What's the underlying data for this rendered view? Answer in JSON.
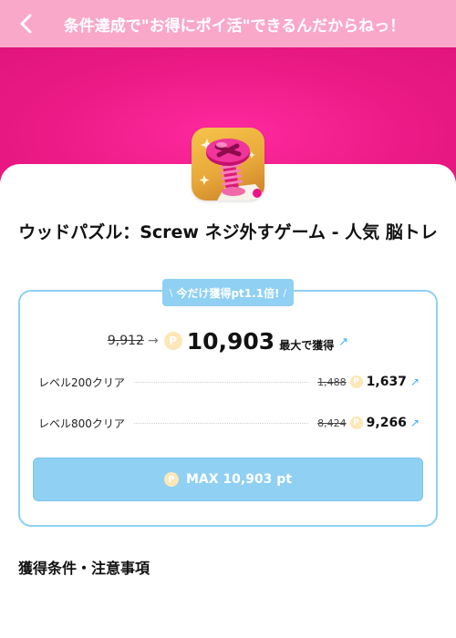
{
  "header": {
    "title": "条件達成で\"お得にポイ活\"できるんだからねっ！"
  },
  "app": {
    "title": "ウッドパズル：Screw ネジ外すゲーム - 人気 脳トレ"
  },
  "offer": {
    "banner_left": "\\",
    "banner_text": "今だけ獲得pt1.1倍!",
    "banner_right": "/",
    "old_total": "9,912",
    "new_total": "10,903",
    "max_label": "最大で獲得",
    "levels": [
      {
        "label": "レベル200クリア",
        "old": "1,488",
        "new": "1,637"
      },
      {
        "label": "レベル800クリア",
        "old": "8,424",
        "new": "9,266"
      }
    ],
    "button_label": "MAX 10,903 pt"
  },
  "conditions": {
    "title": "獲得条件・注意事項"
  },
  "colors": {
    "header_bg": "#f9a8c9",
    "hero_bg": "#ec1a86",
    "accent_blue": "#8fd0f3",
    "link_blue": "#3ab2ea",
    "coin": "#fde7b6"
  },
  "icons": {
    "back": "chevron-left-icon",
    "coin": "point-coin-icon",
    "link": "arrow-up-right-icon",
    "arrow": "arrow-right-icon"
  }
}
